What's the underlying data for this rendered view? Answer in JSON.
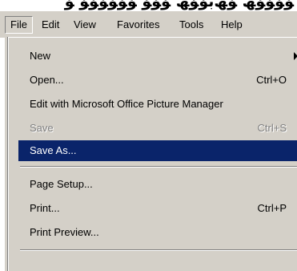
{
  "caption": "ﯚﯚﯚﯚﮫ ﯚﮫﺑﯚﯚﮫ ﯚﯚﯚ ﯚﯚﯚﯚﯚﯚ ﯚ",
  "menubar": {
    "items": [
      "File",
      "Edit",
      "View",
      "Favorites",
      "Tools",
      "Help"
    ],
    "active_index": 0
  },
  "menu": {
    "items": [
      {
        "label": "New",
        "shortcut": "",
        "submenu": true,
        "disabled": false,
        "highlighted": false
      },
      {
        "label": "Open...",
        "shortcut": "Ctrl+O",
        "submenu": false,
        "disabled": false,
        "highlighted": false
      },
      {
        "label": "Edit with Microsoft Office Picture Manager",
        "shortcut": "",
        "submenu": false,
        "disabled": false,
        "highlighted": false
      },
      {
        "label": "Save",
        "shortcut": "Ctrl+S",
        "submenu": false,
        "disabled": true,
        "highlighted": false
      },
      {
        "label": "Save As...",
        "shortcut": "",
        "submenu": false,
        "disabled": false,
        "highlighted": true
      },
      {
        "label": "Page Setup...",
        "shortcut": "",
        "submenu": false,
        "disabled": false,
        "highlighted": false
      },
      {
        "label": "Print...",
        "shortcut": "Ctrl+P",
        "submenu": false,
        "disabled": false,
        "highlighted": false
      },
      {
        "label": "Print Preview...",
        "shortcut": "",
        "submenu": false,
        "disabled": false,
        "highlighted": false
      }
    ]
  },
  "colors": {
    "face": "#d4d0c8",
    "highlight": "#0a246a",
    "disabled_text": "#808080"
  }
}
